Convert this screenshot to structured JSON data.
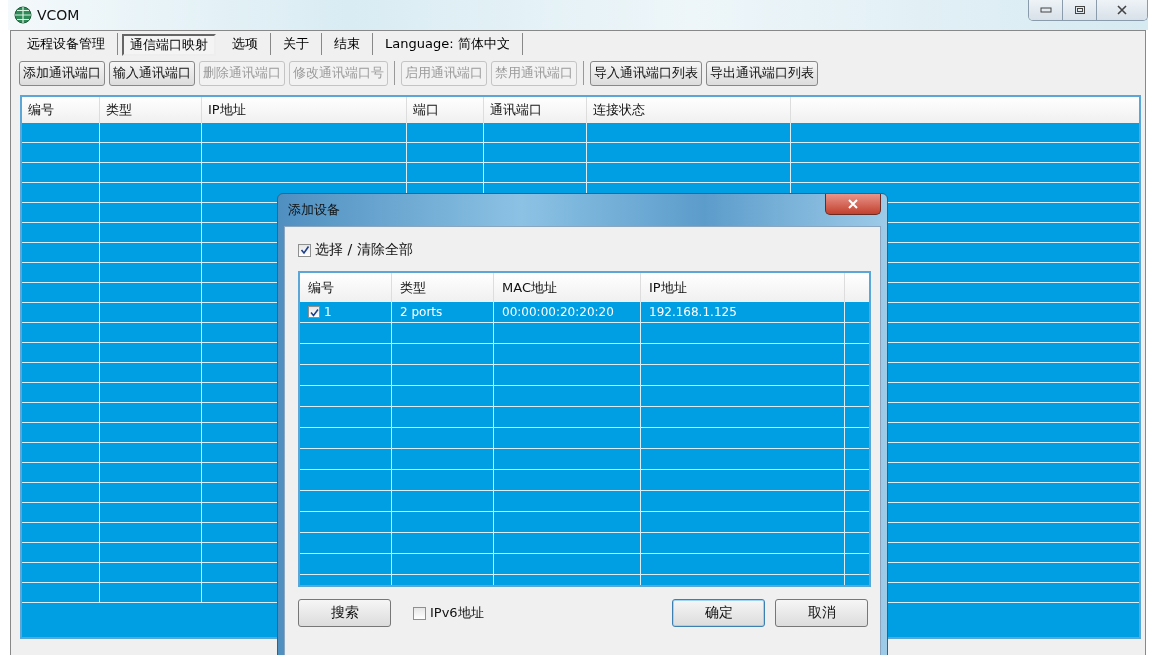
{
  "window": {
    "title": "VCOM"
  },
  "tabs": [
    {
      "label": "远程设备管理",
      "selected": false
    },
    {
      "label": "通信端口映射",
      "selected": true
    },
    {
      "label": "选项",
      "selected": false
    },
    {
      "label": "关于",
      "selected": false
    },
    {
      "label": "结束",
      "selected": false
    },
    {
      "label": "Language: 简体中文",
      "selected": false
    }
  ],
  "toolbar": [
    [
      {
        "label": "添加通讯端口",
        "disabled": false
      },
      {
        "label": "输入通讯端口",
        "disabled": false
      },
      {
        "label": "删除通讯端口",
        "disabled": true
      },
      {
        "label": "修改通讯端口号",
        "disabled": true
      }
    ],
    [
      {
        "label": "启用通讯端口",
        "disabled": true
      },
      {
        "label": "禁用通讯端口",
        "disabled": true
      }
    ],
    [
      {
        "label": "导入通讯端口列表",
        "disabled": false
      },
      {
        "label": "导出通讯端口列表",
        "disabled": false
      }
    ]
  ],
  "table": {
    "columns": [
      "编号",
      "类型",
      "IP地址",
      "端口",
      "通讯端口",
      "连接状态"
    ]
  },
  "dialog": {
    "title": "添加设备",
    "select_all": {
      "label": "选择 / 清除全部",
      "checked": true
    },
    "table": {
      "columns": [
        "编号",
        "类型",
        "MAC地址",
        "IP地址"
      ],
      "rows": [
        {
          "checked": true,
          "cells": [
            "1",
            "2 ports",
            "00:00:00:20:20:20",
            "192.168.1.125"
          ]
        }
      ]
    },
    "search_button": "搜索",
    "ipv6": {
      "label": "IPv6地址",
      "checked": false
    },
    "ok_button": "确定",
    "cancel_button": "取消"
  }
}
